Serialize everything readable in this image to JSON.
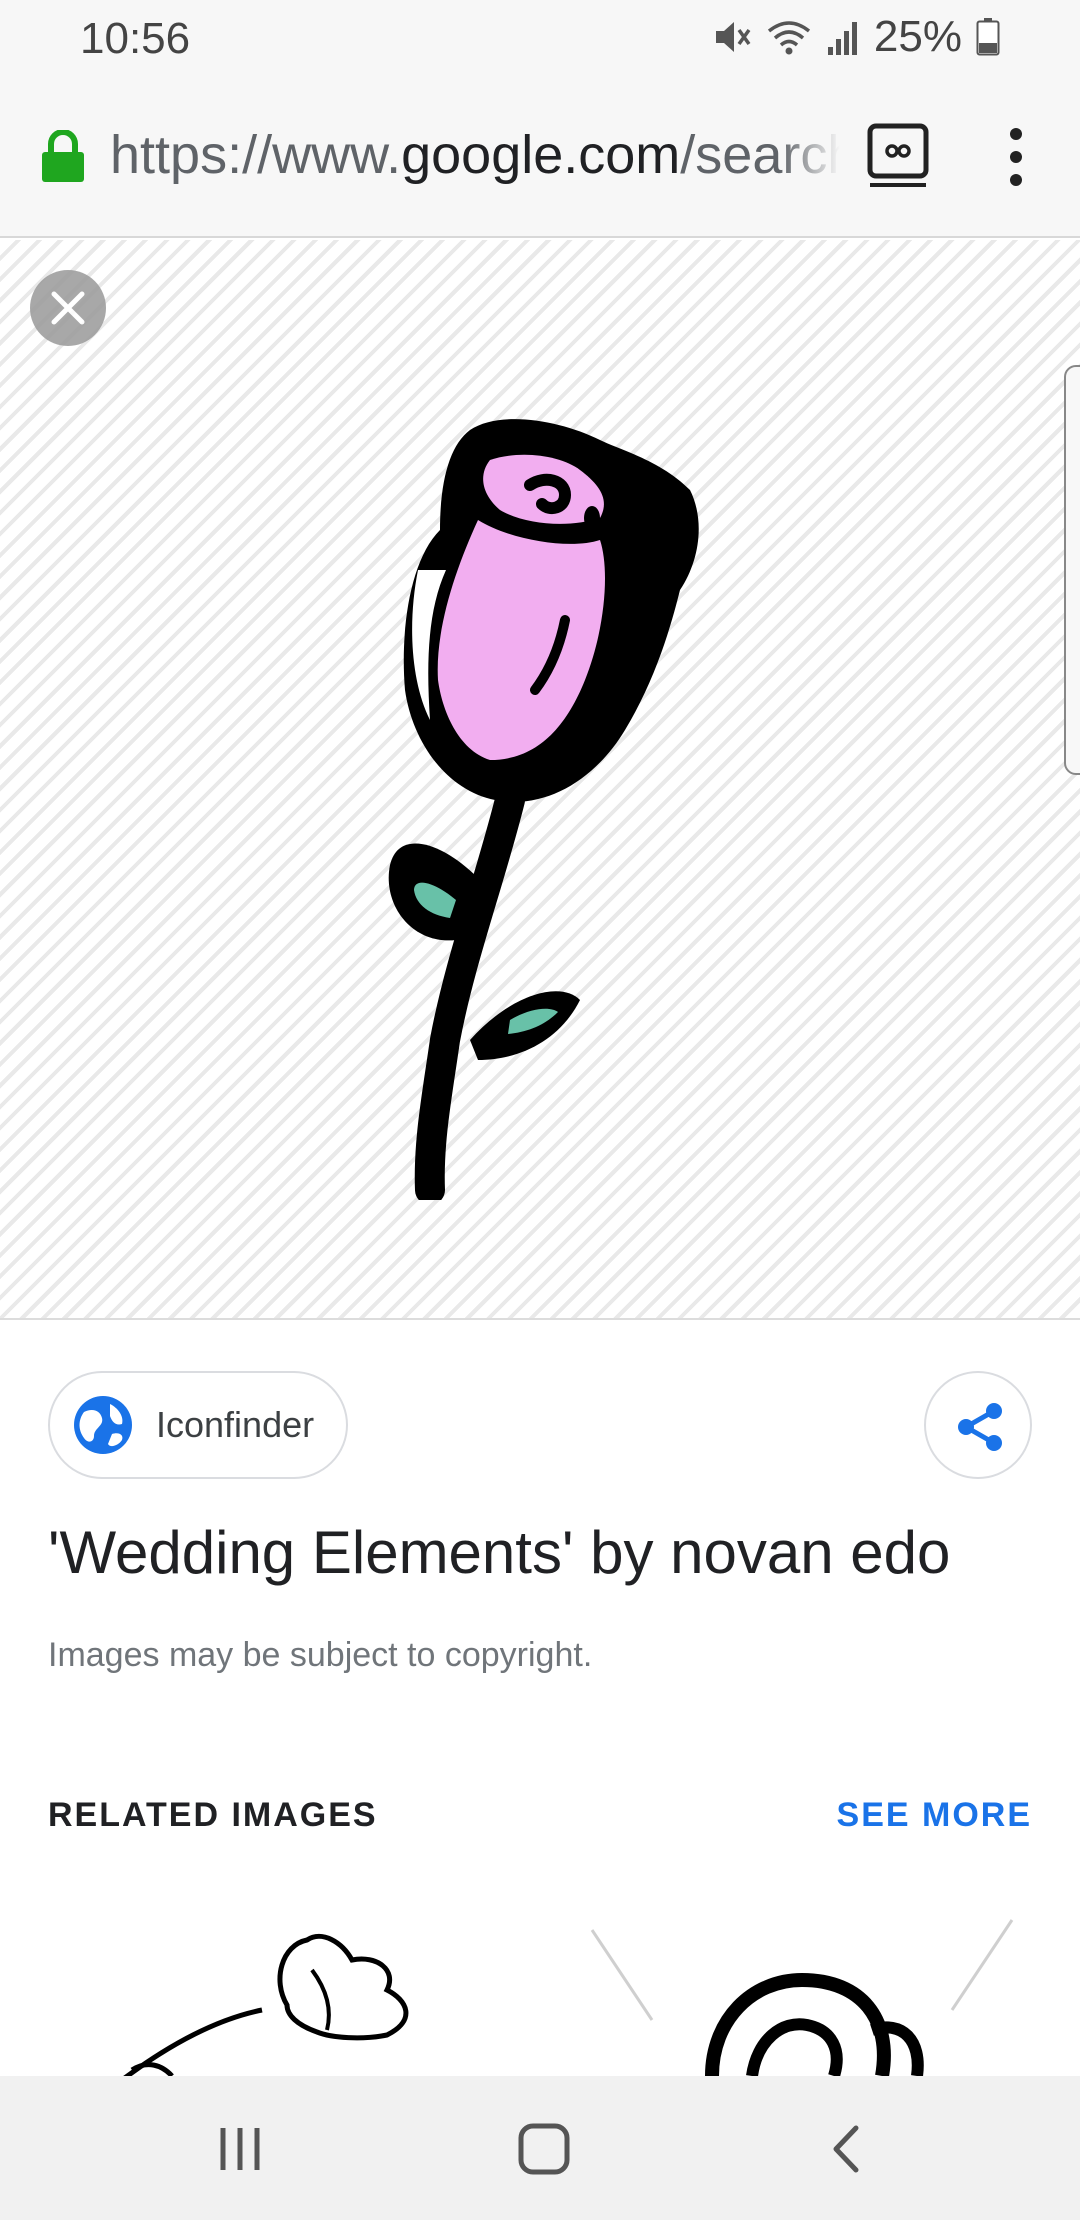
{
  "status_bar": {
    "time": "10:56",
    "battery_percent": "25%",
    "icons": [
      "mute-icon",
      "wifi-icon",
      "signal-icon",
      "battery-icon"
    ]
  },
  "browser": {
    "url_prefix": "https://www.",
    "url_domain": "google.com",
    "url_path": "/search",
    "icons": [
      "lock-icon",
      "tab-switcher-icon",
      "overflow-menu-icon"
    ],
    "lock_color": "#1fa61f"
  },
  "viewer": {
    "icons": [
      "close-icon",
      "rose-image"
    ]
  },
  "result": {
    "source_name": "Iconfinder",
    "title": "'Wedding Elements' by novan edo",
    "copyright_note": "Images may be subject to copyright.",
    "accent_color": "#1a73e8"
  },
  "related": {
    "label": "RELATED IMAGES",
    "see_more": "SEE MORE"
  },
  "nav_bar": {
    "icons": [
      "recents-icon",
      "home-icon",
      "back-icon"
    ]
  }
}
